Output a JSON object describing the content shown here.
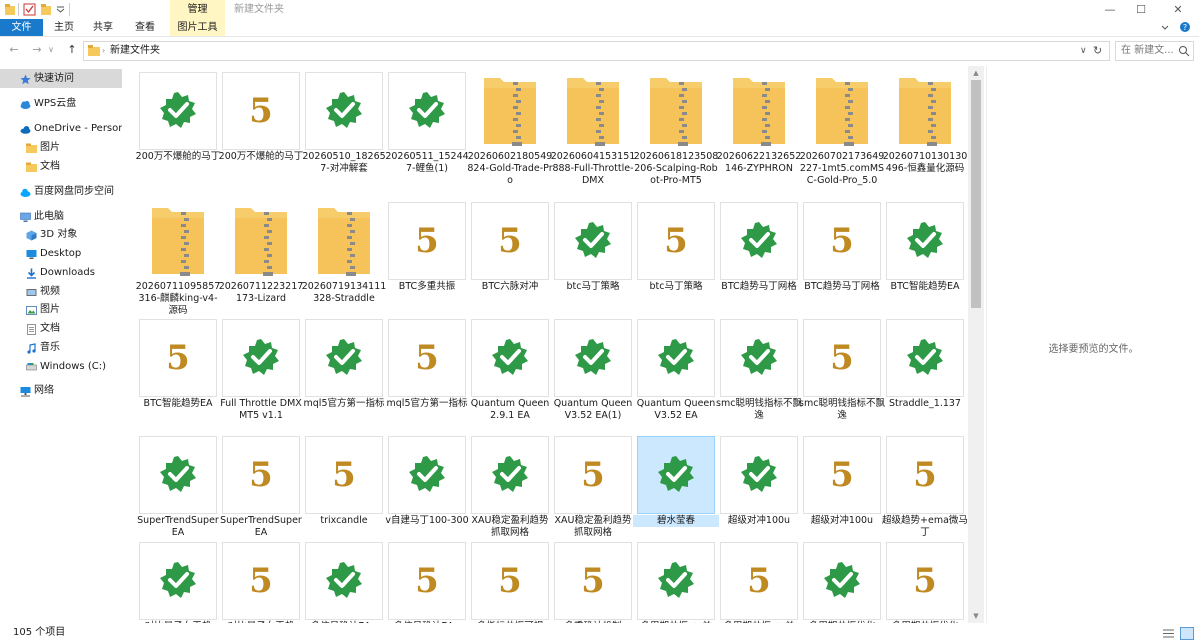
{
  "window": {
    "title": "新建文件夹",
    "context_tab": "管理",
    "controls": {
      "minimize": "—",
      "maximize": "☐",
      "close": "✕"
    }
  },
  "ribbon": {
    "tabs": [
      "文件",
      "主页",
      "共享",
      "查看",
      "图片工具"
    ],
    "expand_icon": "chevron-down-icon",
    "help_icon": "help-icon"
  },
  "nav": {
    "back": "←",
    "forward": "→",
    "recent": "∨",
    "up": "↑",
    "address": "新建文件夹",
    "address_dropdown": "∨",
    "refresh": "↻",
    "search_placeholder": "在 新建文..."
  },
  "sidebar": {
    "items": [
      {
        "label": "快速访问",
        "icon": "star-icon"
      },
      {
        "label": "WPS云盘",
        "icon": "cloud-icon"
      },
      {
        "label": "OneDrive - Persona",
        "icon": "onedrive-icon"
      },
      {
        "label": "图片",
        "icon": "folder-icon"
      },
      {
        "label": "文档",
        "icon": "folder-icon"
      },
      {
        "label": "百度网盘同步空间",
        "icon": "baidu-cloud-icon"
      },
      {
        "label": "此电脑",
        "icon": "computer-icon"
      },
      {
        "label": "3D 对象",
        "icon": "3d-objects-icon"
      },
      {
        "label": "Desktop",
        "icon": "desktop-icon"
      },
      {
        "label": "Downloads",
        "icon": "download-icon"
      },
      {
        "label": "视频",
        "icon": "video-icon"
      },
      {
        "label": "图片",
        "icon": "pictures-icon"
      },
      {
        "label": "文档",
        "icon": "documents-icon"
      },
      {
        "label": "音乐",
        "icon": "music-icon"
      },
      {
        "label": "Windows (C:)",
        "icon": "drive-icon"
      },
      {
        "label": "网络",
        "icon": "network-icon"
      }
    ]
  },
  "files": [
    {
      "name": "200万不爆舱的马丁",
      "type": "ex5"
    },
    {
      "name": "200万不爆舱的马丁",
      "type": "mq5"
    },
    {
      "name": "20260510_182657-对冲解套",
      "type": "ex5"
    },
    {
      "name": "20260511_152447-鲤鱼(1)",
      "type": "ex5"
    },
    {
      "name": "20260602180549824-Gold-Trade-Pro",
      "type": "zip"
    },
    {
      "name": "20260604153151888-Full-Throttle-DMX",
      "type": "zip"
    },
    {
      "name": "20260618123508206-Scalping-Robot-Pro-MT5",
      "type": "zip"
    },
    {
      "name": "20260622132652146-ZYPHRON",
      "type": "zip"
    },
    {
      "name": "20260702173649227-1mt5.comMSC-Gold-Pro_5.0",
      "type": "zip"
    },
    {
      "name": "20260710130130496-恒鑫量化源码",
      "type": "zip"
    },
    {
      "name": "20260711095857316-麒麟king-v4-源码",
      "type": "zip"
    },
    {
      "name": "20260711223217173-Lizard",
      "type": "zip"
    },
    {
      "name": "20260719134111328-Straddle",
      "type": "zip"
    },
    {
      "name": "BTC多重共振",
      "type": "mq5"
    },
    {
      "name": "BTC六脉对冲",
      "type": "mq5"
    },
    {
      "name": "btc马丁策略",
      "type": "ex5"
    },
    {
      "name": "btc马丁策略",
      "type": "mq5"
    },
    {
      "name": "BTC趋势马丁网格",
      "type": "ex5"
    },
    {
      "name": "BTC趋势马丁网格",
      "type": "mq5"
    },
    {
      "name": "BTC智能趋势EA",
      "type": "ex5"
    },
    {
      "name": "BTC智能趋势EA",
      "type": "mq5"
    },
    {
      "name": "Full Throttle DMX MT5 v1.1",
      "type": "ex5"
    },
    {
      "name": "mql5官方第一指标",
      "type": "ex5"
    },
    {
      "name": "mql5官方第一指标",
      "type": "mq5"
    },
    {
      "name": "Quantum Queen 2.9.1 EA",
      "type": "ex5"
    },
    {
      "name": "Quantum Queen V3.52 EA(1)",
      "type": "ex5"
    },
    {
      "name": "Quantum Queen V3.52 EA",
      "type": "ex5"
    },
    {
      "name": "smc聪明钱指标不飘逸",
      "type": "ex5"
    },
    {
      "name": "smc聪明钱指标不飘逸",
      "type": "mq5"
    },
    {
      "name": "Straddle_1.137",
      "type": "ex5"
    },
    {
      "name": "SuperTrendSuperEA",
      "type": "ex5"
    },
    {
      "name": "SuperTrendSuperEA",
      "type": "mq5"
    },
    {
      "name": "trixcandle",
      "type": "mq5"
    },
    {
      "name": "v自建马丁100-300",
      "type": "ex5"
    },
    {
      "name": "XAU稳定盈利趋势抓取网格",
      "type": "ex5"
    },
    {
      "name": "XAU稳定盈利趋势抓取网格",
      "type": "mq5"
    },
    {
      "name": "碧水莹春",
      "type": "ex5",
      "selected": true
    },
    {
      "name": "超级对冲100u",
      "type": "ex5"
    },
    {
      "name": "超级对冲100u",
      "type": "mq5"
    },
    {
      "name": "超级趋势+ema微马丁",
      "type": "mq5"
    },
    {
      "name": "对比量子女王趋",
      "type": "ex5"
    },
    {
      "name": "对比量子女王趋",
      "type": "mq5"
    },
    {
      "name": "多信号确认EA -",
      "type": "ex5"
    },
    {
      "name": "多信号确认EA -",
      "type": "mq5"
    },
    {
      "name": "多指标共振可视",
      "type": "mq5"
    },
    {
      "name": "多重确认机制",
      "type": "mq5"
    },
    {
      "name": "多周期共振 + 关",
      "type": "ex5"
    },
    {
      "name": "多周期共振 + 关",
      "type": "mq5"
    },
    {
      "name": "多周期共振优化",
      "type": "ex5"
    },
    {
      "name": "多周期共振优化",
      "type": "mq5"
    }
  ],
  "preview": {
    "text": "选择要预览的文件。"
  },
  "status": {
    "count": "105 个项目"
  },
  "colors": {
    "accent": "#1979ca",
    "ex5_green": "#2e9a47",
    "mq5_gold": "#c08a22",
    "selection": "#cce8ff",
    "folder_yellow": "#f5c95b"
  }
}
